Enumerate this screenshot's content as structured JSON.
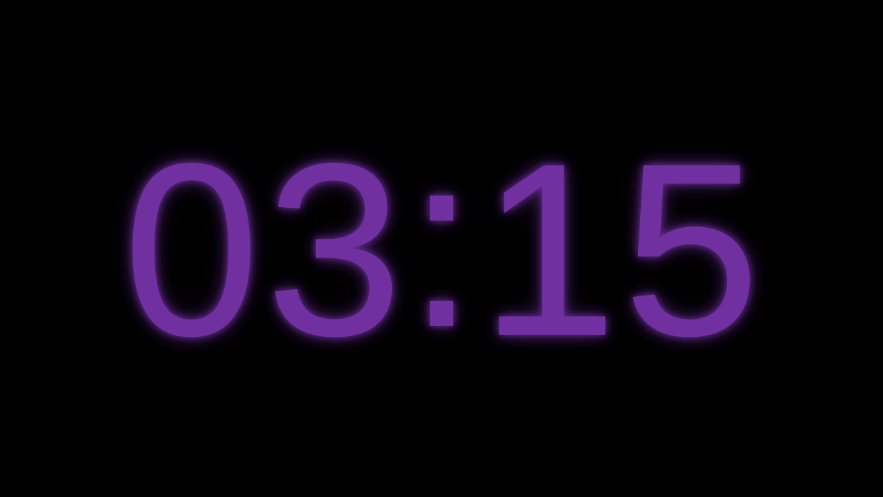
{
  "timer": {
    "minutes_tens": "0",
    "minutes_ones": "3",
    "separator": ":",
    "seconds_tens": "1",
    "seconds_ones": "5"
  },
  "colors": {
    "background": "#000000",
    "digits": "#7030A0"
  }
}
